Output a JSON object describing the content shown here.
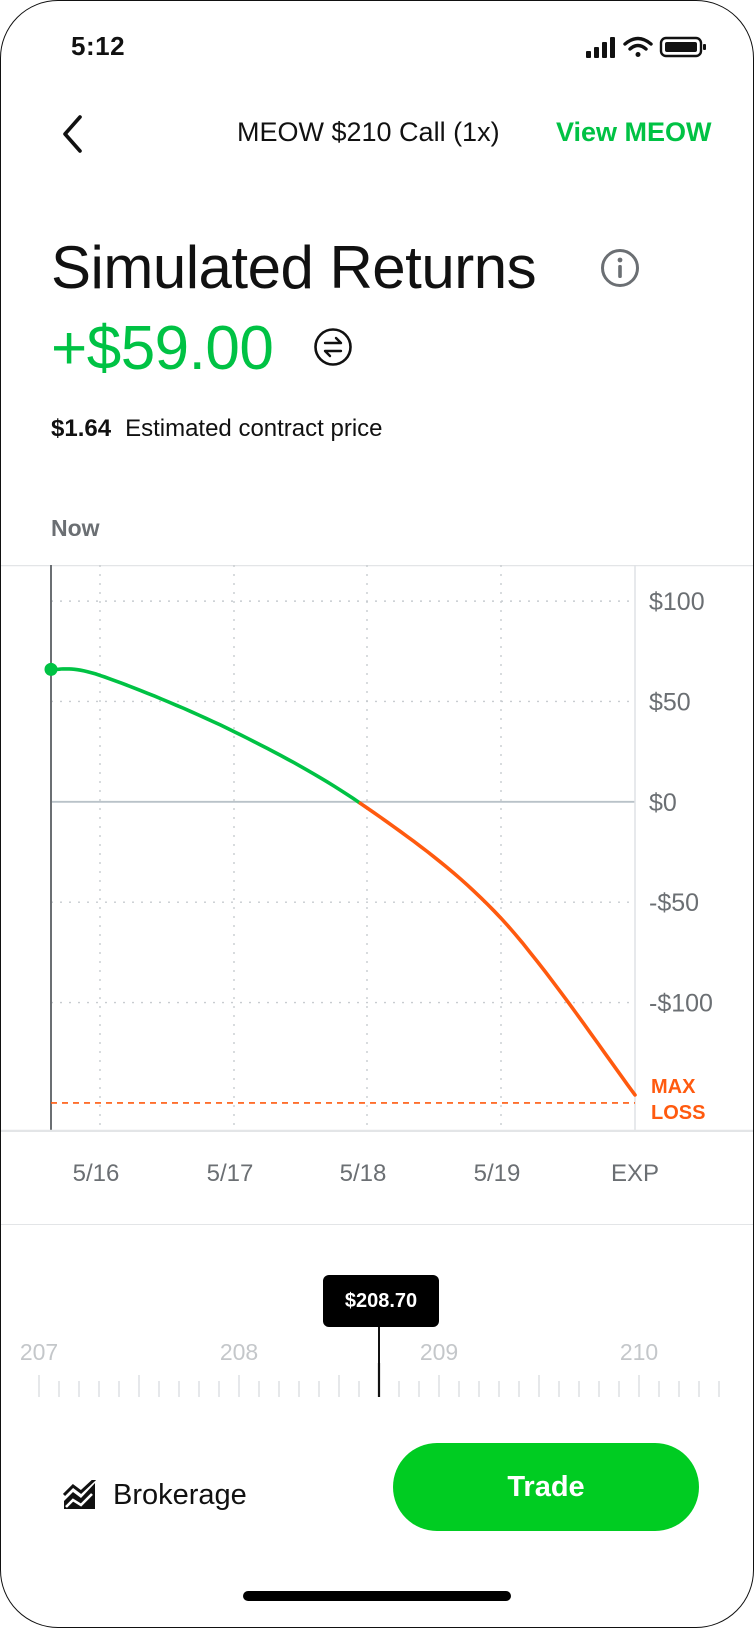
{
  "status_bar": {
    "time": "5:12",
    "icons": [
      "cellular-signal-icon",
      "wifi-icon",
      "battery-icon"
    ]
  },
  "nav": {
    "back_icon": "chevron-left-icon",
    "title": "MEOW $210 Call (1x)",
    "link": "View MEOW"
  },
  "header": {
    "title": "Simulated Returns",
    "info_icon": "info-icon",
    "returns_value": "+$59.00",
    "swap_icon": "swap-arrows-icon",
    "contract_price": "$1.64",
    "contract_price_label": "Estimated contract price",
    "now_label": "Now"
  },
  "colors": {
    "positive": "#00c244",
    "negative": "#ff5a0f",
    "grid": "#c8ccd0",
    "axis_text": "#6b6f73",
    "trade_button": "#00cc22"
  },
  "chart_data": {
    "type": "line",
    "title": "",
    "xlabel": "",
    "ylabel": "",
    "x_categories": [
      "5/16",
      "5/17",
      "5/18",
      "5/19",
      "EXP"
    ],
    "y_ticks": [
      "$100",
      "$50",
      "$0",
      "-$50",
      "-$100"
    ],
    "y_tick_values": [
      100,
      50,
      0,
      -50,
      -100
    ],
    "ylim": [
      -164,
      118
    ],
    "max_loss_label": "MAX LOSS",
    "max_loss_value": -150,
    "series": [
      {
        "points": [
          {
            "x": "Now",
            "y": 66
          },
          {
            "x": "5/16",
            "y": 63
          },
          {
            "x": "5/17",
            "y": 35
          },
          {
            "x": "5/18",
            "y": -3
          },
          {
            "x": "5/19",
            "y": -58
          },
          {
            "x": "EXP",
            "y": -146
          }
        ]
      }
    ],
    "grid": true
  },
  "price_selector": {
    "selected": "$208.70",
    "ruler_labels": [
      "207",
      "208",
      "209",
      "210"
    ],
    "ruler_values": [
      207,
      208,
      209,
      210
    ],
    "selected_value": 208.7
  },
  "bottom": {
    "brokerage_label": "Brokerage",
    "brokerage_icon": "brokerage-chart-icon",
    "trade_label": "Trade"
  }
}
